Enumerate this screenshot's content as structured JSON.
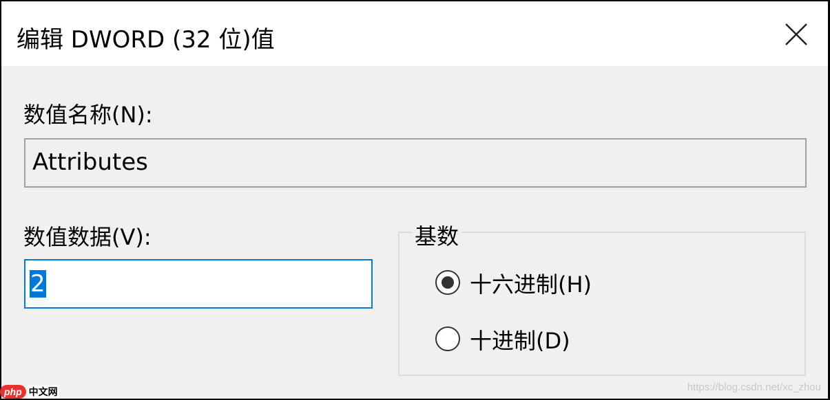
{
  "dialog": {
    "title": "编辑 DWORD (32 位)值"
  },
  "name_section": {
    "label": "数值名称(N):",
    "value": "Attributes"
  },
  "data_section": {
    "label": "数值数据(V):",
    "value": "2"
  },
  "base_group": {
    "title": "基数",
    "options": [
      {
        "label": "十六进制(H)",
        "selected": true
      },
      {
        "label": "十进制(D)",
        "selected": false
      }
    ]
  },
  "watermark": {
    "text": "https://blog.csdn.net/xc_zhou"
  },
  "badge": {
    "logo_text": "php",
    "site_text": "中文网"
  },
  "colors": {
    "accent": "#0078d7",
    "dialog_bg": "#f0f0f0",
    "titlebar_bg": "#ffffff"
  },
  "icons": {
    "close": "close-icon"
  }
}
